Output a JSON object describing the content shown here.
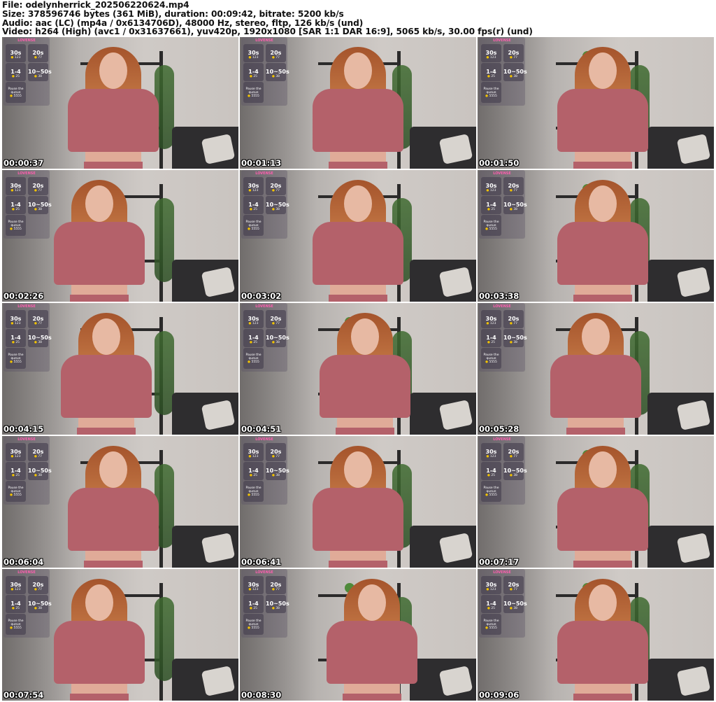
{
  "header": {
    "file": "File: odelynherrick_202506220624.mp4",
    "size": "Size: 378596746 bytes (361 MiB), duration: 00:09:42, bitrate: 5200 kb/s",
    "audio": "Audio: aac (LC) (mp4a / 0x6134706D), 48000 Hz, stereo, fltp, 126 kb/s (und)",
    "video": "Video: h264 (High) (avc1 / 0x31637661), yuv420p, 1920x1080 [SAR 1:1 DAR 16:9], 5065 kb/s, 30.00 fps(r) (und)"
  },
  "overlay": {
    "brand": "LOVENSE",
    "tiles": [
      {
        "value": "30s",
        "tokens": "123"
      },
      {
        "value": "20s",
        "tokens": "77"
      },
      {
        "value": "1-4",
        "tokens": "25"
      },
      {
        "value": "10~50s",
        "tokens": "38"
      }
    ],
    "queue_label": "Pause the queue",
    "queue_tokens": "5555"
  },
  "thumbnails": [
    {
      "timestamp": "00:00:37"
    },
    {
      "timestamp": "00:01:13"
    },
    {
      "timestamp": "00:01:50"
    },
    {
      "timestamp": "00:02:26"
    },
    {
      "timestamp": "00:03:02"
    },
    {
      "timestamp": "00:03:38"
    },
    {
      "timestamp": "00:04:15"
    },
    {
      "timestamp": "00:04:51"
    },
    {
      "timestamp": "00:05:28"
    },
    {
      "timestamp": "00:06:04"
    },
    {
      "timestamp": "00:06:41"
    },
    {
      "timestamp": "00:07:17"
    },
    {
      "timestamp": "00:07:54"
    },
    {
      "timestamp": "00:08:30"
    },
    {
      "timestamp": "00:09:06"
    }
  ]
}
